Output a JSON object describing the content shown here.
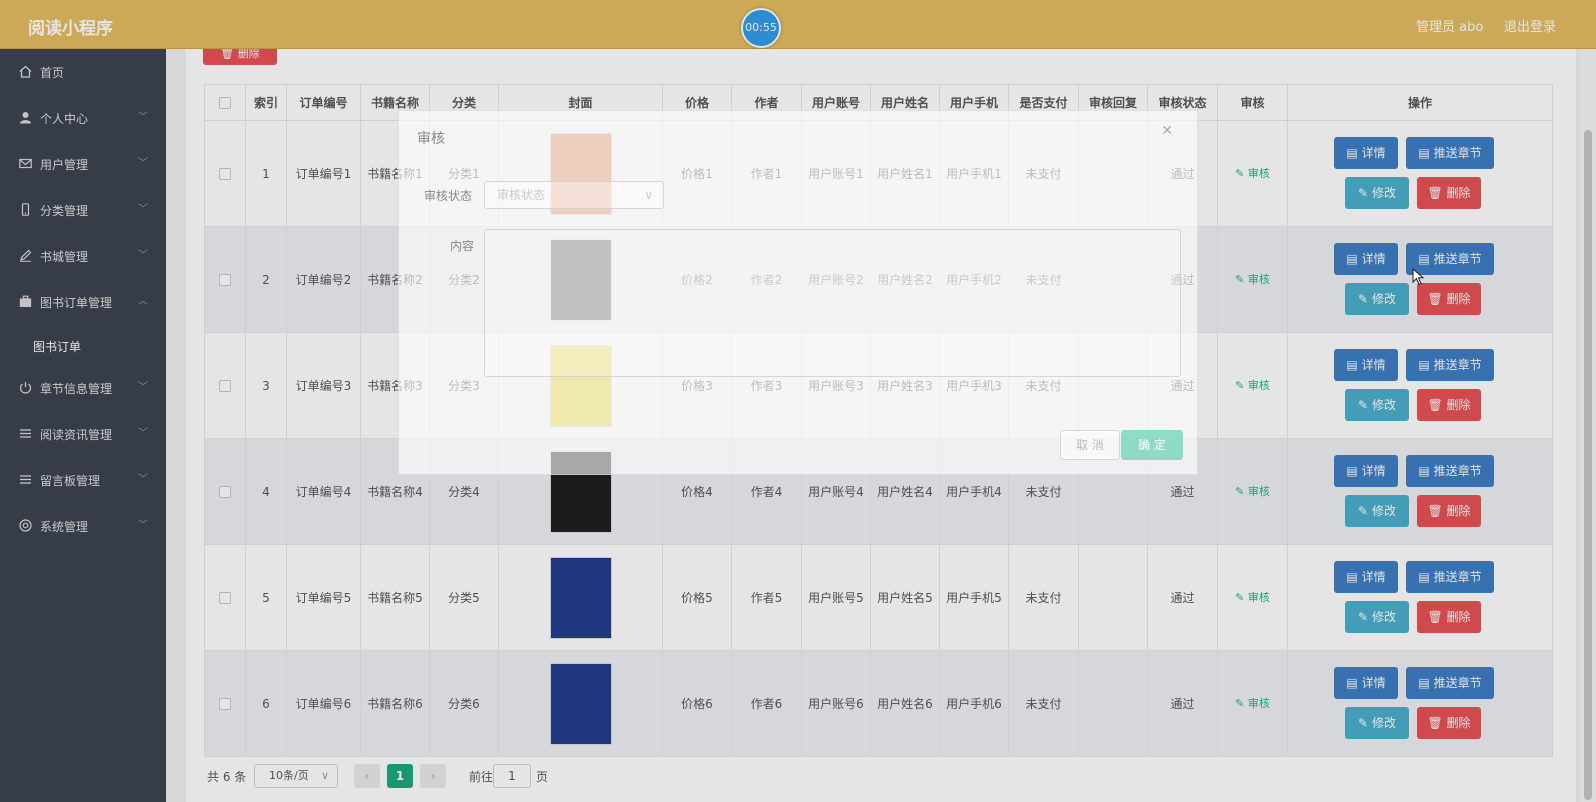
{
  "header": {
    "app_title": "阅读小程序",
    "timer": "00:55",
    "admin_label": "管理员 abo",
    "logout": "退出登录"
  },
  "sidebar": {
    "items": [
      {
        "label": "首页",
        "icon": "home-icon",
        "has_children": false
      },
      {
        "label": "个人中心",
        "icon": "user-icon",
        "has_children": true
      },
      {
        "label": "用户管理",
        "icon": "mail-icon",
        "has_children": true
      },
      {
        "label": "分类管理",
        "icon": "phone-icon",
        "has_children": true
      },
      {
        "label": "书城管理",
        "icon": "pen-icon",
        "has_children": true
      },
      {
        "label": "图书订单管理",
        "icon": "briefcase-icon",
        "has_children": true,
        "expanded": true
      },
      {
        "label": "章节信息管理",
        "icon": "power-icon",
        "has_children": true
      },
      {
        "label": "阅读资讯管理",
        "icon": "list-icon",
        "has_children": true
      },
      {
        "label": "留言板管理",
        "icon": "list-icon",
        "has_children": true
      },
      {
        "label": "系统管理",
        "icon": "settings-icon",
        "has_children": true
      }
    ],
    "sub_item": "图书订单"
  },
  "toolbar": {
    "delete_label": "删除"
  },
  "table": {
    "columns": [
      "索引",
      "订单编号",
      "书籍名称",
      "分类",
      "封面",
      "价格",
      "作者",
      "用户账号",
      "用户姓名",
      "用户手机",
      "是否支付",
      "审核回复",
      "审核状态",
      "审核",
      "操作"
    ],
    "rows": [
      {
        "index": "1",
        "order_no": "订单编号1",
        "book_name": "书籍名称1",
        "category": "分类1",
        "price": "价格1",
        "author": "作者1",
        "account": "用户账号1",
        "username": "用户姓名1",
        "phone": "用户手机1",
        "paid": "未支付",
        "reply": "",
        "status": "通过",
        "cover_color": "#ea8a55"
      },
      {
        "index": "2",
        "order_no": "订单编号2",
        "book_name": "书籍名称2",
        "category": "分类2",
        "price": "价格2",
        "author": "作者2",
        "account": "用户账号2",
        "username": "用户姓名2",
        "phone": "用户手机2",
        "paid": "未支付",
        "reply": "",
        "status": "通过",
        "cover_color": "#3b3b3b"
      },
      {
        "index": "3",
        "order_no": "订单编号3",
        "book_name": "书籍名称3",
        "category": "分类3",
        "price": "价格3",
        "author": "作者3",
        "account": "用户账号3",
        "username": "用户姓名3",
        "phone": "用户手机3",
        "paid": "未支付",
        "reply": "",
        "status": "通过",
        "cover_color": "#f0dc2c"
      },
      {
        "index": "4",
        "order_no": "订单编号4",
        "book_name": "书籍名称4",
        "category": "分类4",
        "price": "价格4",
        "author": "作者4",
        "account": "用户账号4",
        "username": "用户姓名4",
        "phone": "用户手机4",
        "paid": "未支付",
        "reply": "",
        "status": "通过",
        "cover_color": "#1b1b1b"
      },
      {
        "index": "5",
        "order_no": "订单编号5",
        "book_name": "书籍名称5",
        "category": "分类5",
        "price": "价格5",
        "author": "作者5",
        "account": "用户账号5",
        "username": "用户姓名5",
        "phone": "用户手机5",
        "paid": "未支付",
        "reply": "",
        "status": "通过",
        "cover_color": "#1f3a8c"
      },
      {
        "index": "6",
        "order_no": "订单编号6",
        "book_name": "书籍名称6",
        "category": "分类6",
        "price": "价格6",
        "author": "作者6",
        "account": "用户账号6",
        "username": "用户姓名6",
        "phone": "用户手机6",
        "paid": "未支付",
        "reply": "",
        "status": "通过",
        "cover_color": "#1f3a8c"
      }
    ],
    "audit_label": "审核",
    "actions": {
      "detail": "详情",
      "push": "推送章节",
      "edit": "修改",
      "delete": "删除"
    }
  },
  "pagination": {
    "total": "共 6 条",
    "page_size": "10条/页",
    "current_page": "1",
    "goto_label": "前往",
    "goto_value": "1",
    "page_suffix": "页"
  },
  "dialog": {
    "title": "审核",
    "status_label": "审核状态",
    "status_placeholder": "审核状态",
    "content_label": "内容",
    "cancel": "取 消",
    "ok": "确 定"
  },
  "colors": {
    "header": "#e3bb5e",
    "sidebar": "#38404e",
    "primary": "#3a7bc2",
    "info": "#48aeca",
    "danger": "#e84f53",
    "success": "#16a77f"
  }
}
